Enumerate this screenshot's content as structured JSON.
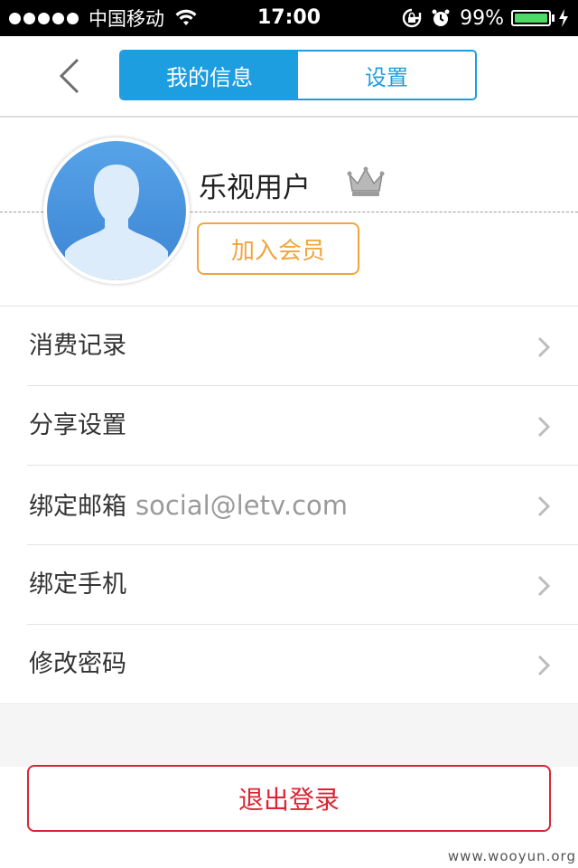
{
  "status_bar": {
    "carrier": "中国移动",
    "time": "17:00",
    "battery_percent": "99%",
    "battery_level": 0.99,
    "icons": [
      "signal-dots-icon",
      "wifi-icon",
      "rotation-lock-icon",
      "alarm-icon",
      "battery-icon",
      "charging-bolt-icon"
    ]
  },
  "nav": {
    "back_icon": "chevron-left-icon",
    "tabs": [
      {
        "label": "我的信息",
        "active": true
      },
      {
        "label": "设置",
        "active": false
      }
    ]
  },
  "profile": {
    "username": "乐视用户",
    "vip_icon": "crown-icon",
    "join_button": "加入会员"
  },
  "menu": {
    "items": [
      {
        "label": "消费记录",
        "value": ""
      },
      {
        "label": "分享设置",
        "value": ""
      },
      {
        "label": "绑定邮箱",
        "value": "social@letv.com"
      },
      {
        "label": "绑定手机",
        "value": ""
      },
      {
        "label": "修改密码",
        "value": ""
      }
    ]
  },
  "logout_button": "退出登录",
  "watermark": "www.wooyun.org",
  "colors": {
    "accent_blue": "#1d9ee0",
    "join_orange": "#f0a53f",
    "logout_red": "#d92534",
    "battery_green": "#4cd964"
  }
}
